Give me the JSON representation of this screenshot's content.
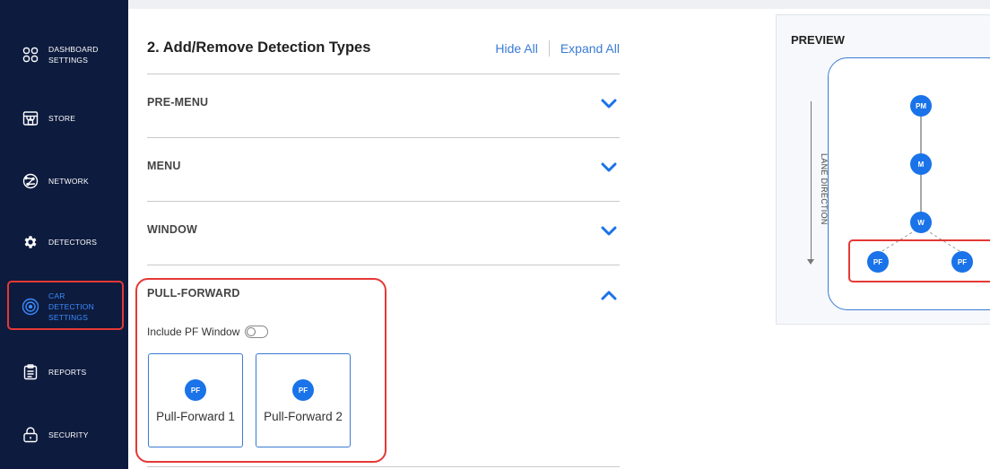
{
  "sidebar": {
    "items": [
      {
        "label": "DASHBOARD SETTINGS",
        "icon": "dashboard-grid-icon"
      },
      {
        "label": "STORE",
        "icon": "store-icon"
      },
      {
        "label": "NETWORK",
        "icon": "network-icon"
      },
      {
        "label": "DETECTORS",
        "icon": "gear-icon"
      },
      {
        "label": "CAR DETECTION SETTINGS",
        "icon": "target-icon",
        "active": true
      },
      {
        "label": "REPORTS",
        "icon": "clipboard-icon"
      },
      {
        "label": "SECURITY",
        "icon": "lock-icon"
      }
    ],
    "active_color": "#3a8cff",
    "background": "#0d1b3e"
  },
  "main": {
    "title": "2. Add/Remove Detection Types",
    "hide_all": "Hide All",
    "expand_all": "Expand All",
    "sections": [
      {
        "label": "PRE-MENU",
        "expanded": false
      },
      {
        "label": "MENU",
        "expanded": false
      },
      {
        "label": "WINDOW",
        "expanded": false
      },
      {
        "label": "PULL-FORWARD",
        "expanded": true
      }
    ],
    "pull_forward": {
      "include_label": "Include PF Window",
      "toggle_on": false,
      "cards": [
        {
          "badge": "PF",
          "name": "Pull-Forward 1"
        },
        {
          "badge": "PF",
          "name": "Pull-Forward 2"
        }
      ]
    }
  },
  "preview": {
    "title": "PREVIEW",
    "lane_label": "LANE DIRECTION",
    "nodes": {
      "pm": "PM",
      "m": "M",
      "w": "W",
      "pf1": "PF",
      "pf2": "PF"
    }
  },
  "colors": {
    "accent": "#1a73e8",
    "link": "#3a7bd5",
    "highlight": "#e53935"
  }
}
